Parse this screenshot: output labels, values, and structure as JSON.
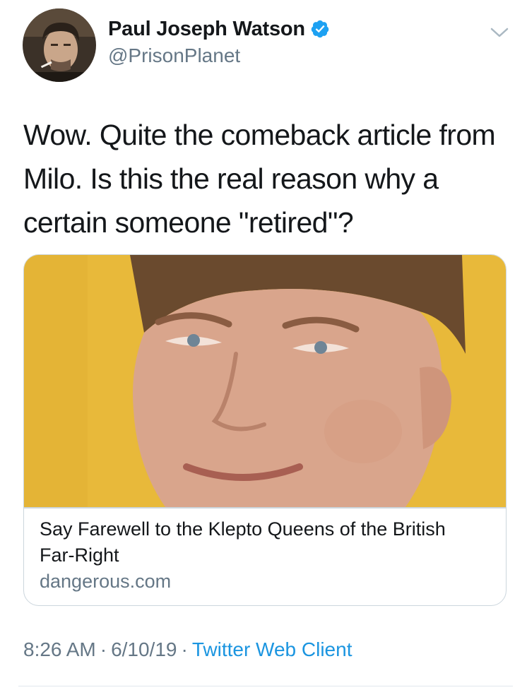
{
  "author": {
    "display_name": "Paul Joseph Watson",
    "handle": "@PrisonPlanet",
    "verified": true,
    "avatar_icon": "user-avatar"
  },
  "tweet": {
    "text": "Wow. Quite the comeback article from Milo. Is this the real reason why a certain someone \"retired\"?"
  },
  "card": {
    "title": "Say Farewell to the Klepto Queens of the British Far-Right",
    "domain": "dangerous.com",
    "image_icon": "article-thumbnail"
  },
  "meta": {
    "time": "8:26 AM",
    "separator": "·",
    "date": "6/10/19",
    "source": "Twitter Web Client"
  },
  "colors": {
    "text": "#14171a",
    "secondary": "#657786",
    "link": "#1b95e0",
    "verified": "#1da1f2",
    "border": "#ccd6dd",
    "card_background": "#e8b93a"
  },
  "icons": {
    "verified": "verified-badge-icon",
    "menu": "chevron-down-icon"
  }
}
